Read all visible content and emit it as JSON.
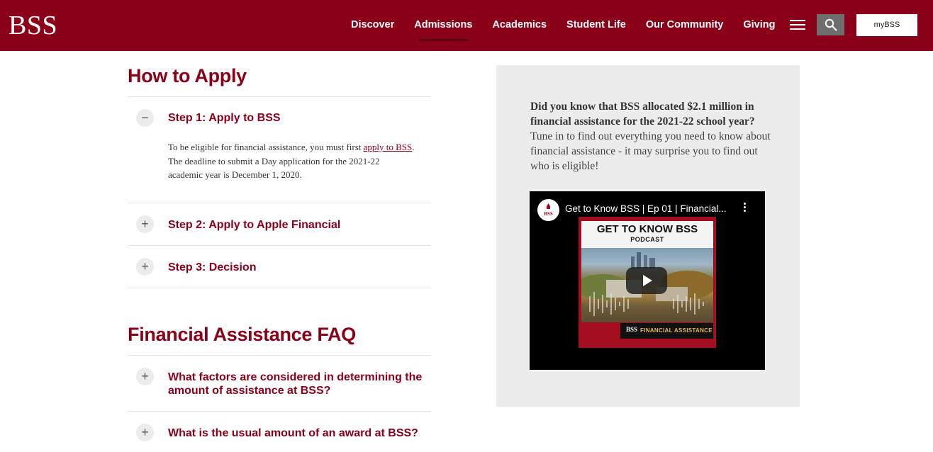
{
  "header": {
    "logo": "BSS",
    "nav": [
      "Discover",
      "Admissions",
      "Academics",
      "Student Life",
      "Our Community",
      "Giving"
    ],
    "active_nav": "Admissions",
    "mybss_label": "myBSS"
  },
  "how_to_apply": {
    "title": "How to Apply",
    "steps": [
      {
        "icon": "minus-icon",
        "toggle": "−",
        "title": "Step 1: Apply to BSS",
        "expanded": true
      },
      {
        "icon": "plus-icon",
        "toggle": "+",
        "title": "Step 2: Apply to Apple Financial",
        "expanded": false
      },
      {
        "icon": "plus-icon",
        "toggle": "+",
        "title": "Step 3: Decision",
        "expanded": false
      }
    ],
    "step1_body": {
      "text_before": "To be eligible for financial assistance, you must first ",
      "link": "apply to BSS",
      "text_after": ". The deadline to submit a Day application for the 2021-22 academic year is December 1, 2020."
    }
  },
  "faq": {
    "title": "Financial Assistance FAQ",
    "items": [
      {
        "toggle": "+",
        "title": "What factors are considered in determining the amount of assistance at BSS?"
      },
      {
        "toggle": "+",
        "title": "What is the usual amount of an award at BSS?"
      }
    ]
  },
  "sidebar": {
    "bold_text": "Did you know that BSS allocated $2.1 million in financial assistance for the 2021-22 school year?",
    "text": "Tune in to find out everything you need to know about financial assistance - it may surprise you to find out who is eligible!",
    "video": {
      "title": "Get to Know BSS | Ep 01 | Financial...",
      "thumb_heading": "GET TO KNOW BSS",
      "thumb_subheading": "PODCAST",
      "thumb_band_logo": "BSS",
      "thumb_band": "FINANCIAL ASSISTANCE"
    }
  },
  "colors": {
    "brand": "#8b0019",
    "sidebar_bg": "#ececec"
  }
}
